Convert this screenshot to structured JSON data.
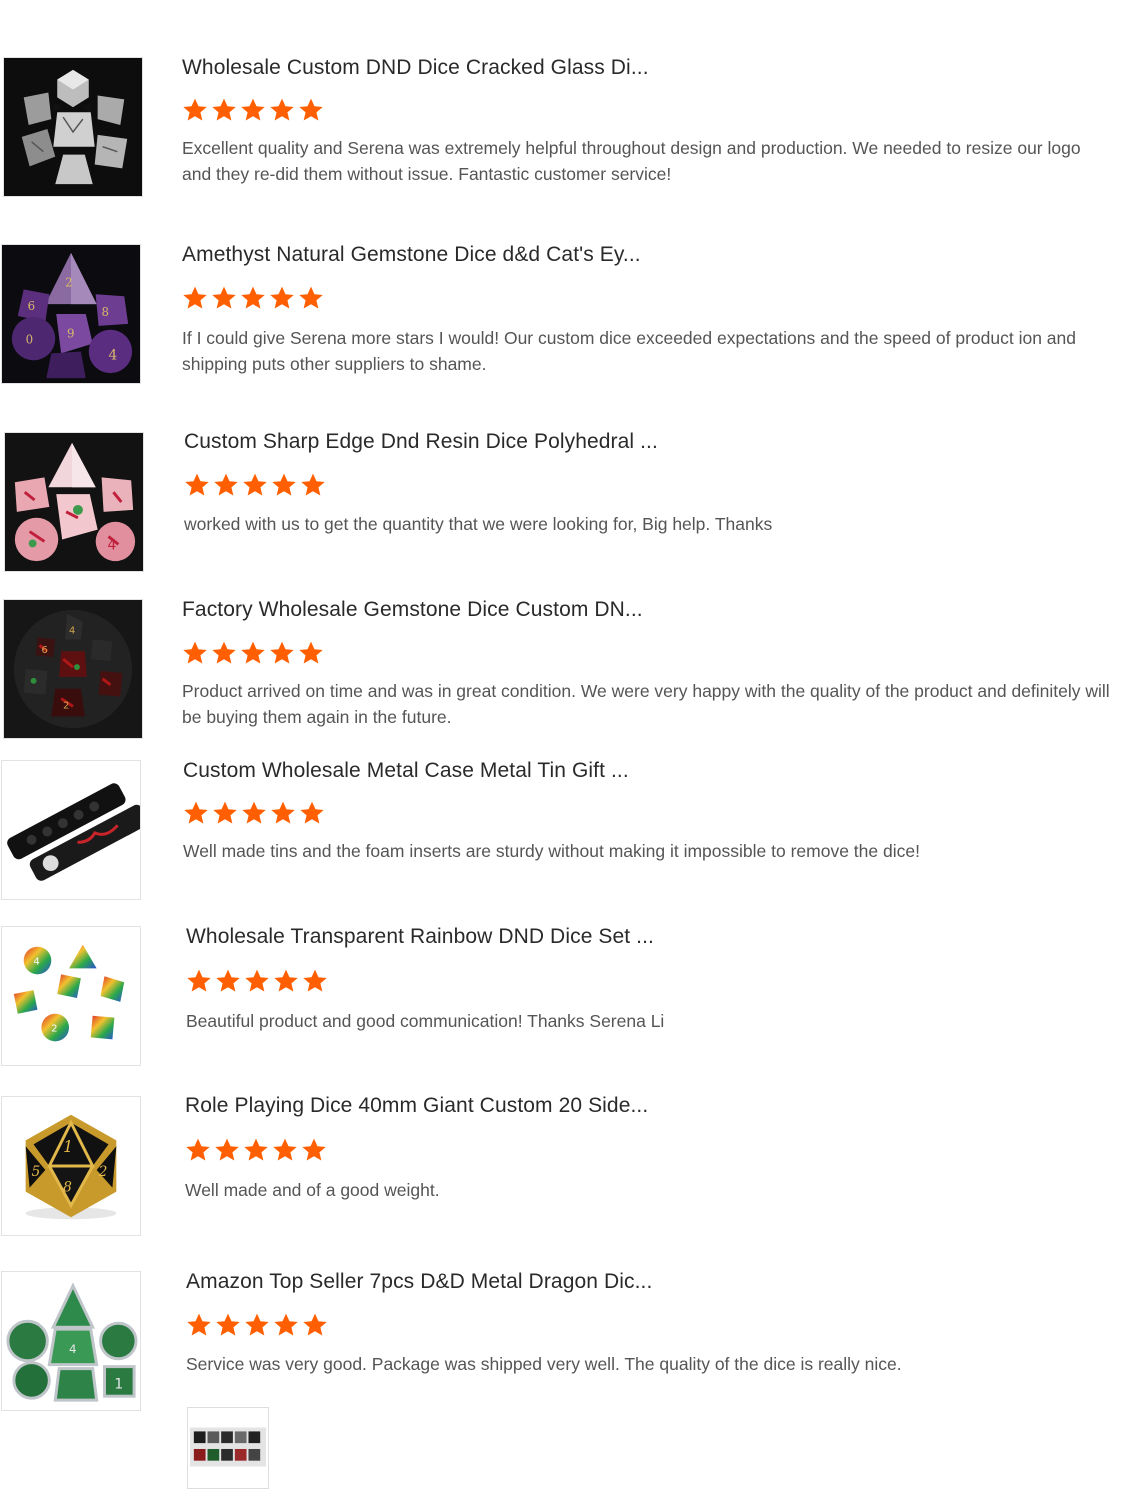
{
  "reviews": [
    {
      "product_title": "Wholesale Custom DND Dice Cracked Glass Di...",
      "rating": 5,
      "review_text": "Excellent quality and Serena was extremely helpful throughout design and production. We needed to resize our logo and they re-did them without issue. Fantastic customer service!",
      "thumbnail": "cracked-glass-dice-image"
    },
    {
      "product_title": "Amethyst Natural Gemstone Dice d&d Cat's Ey...",
      "rating": 5,
      "review_text": "If I could give Serena more stars I would! Our custom dice exceeded expectations and the speed of product ion and shipping puts other suppliers to shame.",
      "thumbnail": "amethyst-dice-image"
    },
    {
      "product_title": "Custom Sharp Edge Dnd Resin Dice Polyhedral ...",
      "rating": 5,
      "review_text": "worked with us to get the quantity that we were looking for, Big help. Thanks",
      "thumbnail": "pink-resin-dice-image"
    },
    {
      "product_title": "Factory Wholesale Gemstone Dice Custom DN...",
      "rating": 5,
      "review_text": "Product arrived on time and was in great condition. We were very happy with the quality of the product and definitely will be buying them again in the future.",
      "thumbnail": "red-black-gemstone-dice-image"
    },
    {
      "product_title": "Custom Wholesale Metal Case Metal Tin Gift ...",
      "rating": 5,
      "review_text": "Well made tins and the foam inserts are sturdy without making it impossible to remove the dice!",
      "thumbnail": "metal-tin-case-image"
    },
    {
      "product_title": "Wholesale Transparent Rainbow DND Dice Set ...",
      "rating": 5,
      "review_text": "Beautiful product and good communication! Thanks Serena Li",
      "thumbnail": "rainbow-dice-image"
    },
    {
      "product_title": "Role Playing Dice 40mm Giant Custom 20 Side...",
      "rating": 5,
      "review_text": "Well made and of a good weight.",
      "thumbnail": "giant-d20-image"
    },
    {
      "product_title": "Amazon Top Seller 7pcs D&D Metal Dragon Dic...",
      "rating": 5,
      "review_text": "Service was very good. Package was shipped very well. The quality of the dice is really nice.",
      "thumbnail": "green-metal-dice-image",
      "attachment": "review-photo-thumbnail"
    }
  ],
  "colors": {
    "star": "#ff5f00",
    "title": "#2a2a2a",
    "text": "#555555"
  }
}
